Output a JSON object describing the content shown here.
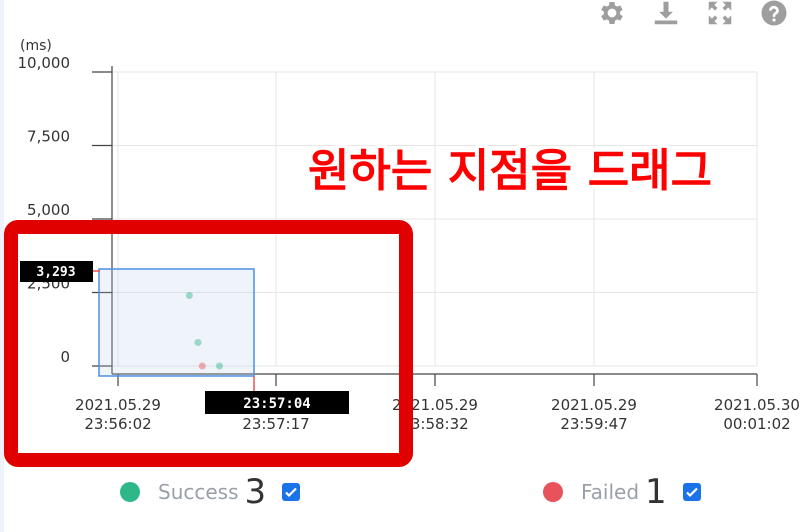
{
  "toolbar": {
    "icons": [
      "gear-icon",
      "download-icon",
      "expand-icon",
      "help-icon"
    ],
    "color": "#9e9e9e"
  },
  "chart_data": {
    "type": "scatter",
    "ylabel": "(ms)",
    "yticks": [
      "10,000",
      "7,500",
      "5,000",
      "2,500",
      "0"
    ],
    "ylim": [
      0,
      10000
    ],
    "xticks": [
      {
        "date": "2021.05.29",
        "time": "23:56:02"
      },
      {
        "date": "2021.05.29",
        "time": "23:57:17"
      },
      {
        "date": "2021.05.29",
        "time": "23:58:32"
      },
      {
        "date": "2021.05.29",
        "time": "23:59:47"
      },
      {
        "date": "2021.05.30",
        "time": "00:01:02"
      }
    ],
    "xlim": [
      "2021.05.29 23:56:02",
      "2021.05.30 00:01:02"
    ],
    "grid": true,
    "series": [
      {
        "name": "Success",
        "color": "#2eb88a",
        "points": [
          {
            "x": "2021.05.29 23:56:38",
            "y": 2400
          },
          {
            "x": "2021.05.29 23:56:42",
            "y": 800
          },
          {
            "x": "2021.05.29 23:56:52",
            "y": 0
          }
        ]
      },
      {
        "name": "Failed",
        "color": "#e8535b",
        "points": [
          {
            "x": "2021.05.29 23:56:44",
            "y": 0
          }
        ]
      }
    ],
    "selection": {
      "y_readout": "3,293",
      "x_readout": "23:57:04"
    }
  },
  "annotation": {
    "text": "원하는 지점을 드래그"
  },
  "legend": {
    "items": [
      {
        "label": "Success",
        "count": "3",
        "color": "#2eb88a",
        "checked": true
      },
      {
        "label": "Failed",
        "count": "1",
        "color": "#e8535b",
        "checked": true
      }
    ]
  },
  "colors": {
    "highlight_frame": "#e00000",
    "selection": "#4a90e2",
    "axis": "#444444",
    "grid": "#e6e6e6"
  }
}
